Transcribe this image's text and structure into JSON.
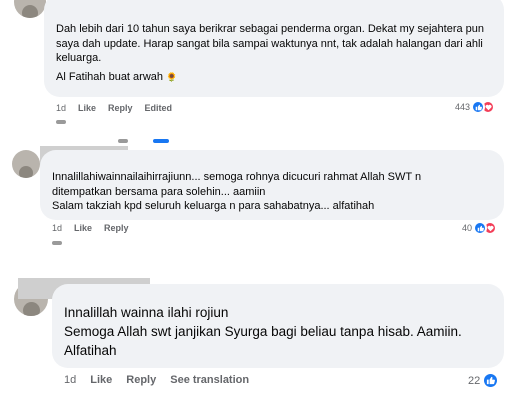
{
  "comments": [
    {
      "text_lines": [
        "Dah lebih dari 10 tahun saya berikrar sebagai penderma organ. Dekat my sejahtera pun",
        "saya dah update. Harap sangat bila sampai waktunya nnt, tak adalah halangan dari ahli",
        "keluarga.",
        "Al Fatihah buat arwah"
      ],
      "emoji": "🌻",
      "time": "1d",
      "like_label": "Like",
      "reply_label": "Reply",
      "edited_label": "Edited",
      "reaction_count": "443"
    },
    {
      "text_lines": [
        "Innalillahiwainnailaihirrajiunn... semoga rohnya dicucuri rahmat Allah SWT n",
        "ditempatkan bersama para solehin... aamiin",
        "Salam takziah kpd seluruh keluarga n para sahabatnya... alfatihah"
      ],
      "time": "1d",
      "like_label": "Like",
      "reply_label": "Reply",
      "reaction_count": "40"
    },
    {
      "text_lines": [
        "Innalillah wainna ilahi rojiun",
        "Semoga Allah swt janjikan Syurga bagi beliau tanpa hisab. Aamiin.",
        "Alfatihah"
      ],
      "time": "1d",
      "like_label": "Like",
      "reply_label": "Reply",
      "translate_label": "See translation",
      "reaction_count": "22"
    }
  ],
  "colors": {
    "bubble": "#f0f2f5",
    "meta": "#65676b",
    "like": "#1877f2",
    "love": "#f33e58"
  },
  "icons": [
    "like-icon",
    "love-icon",
    "sunflower-emoji"
  ]
}
